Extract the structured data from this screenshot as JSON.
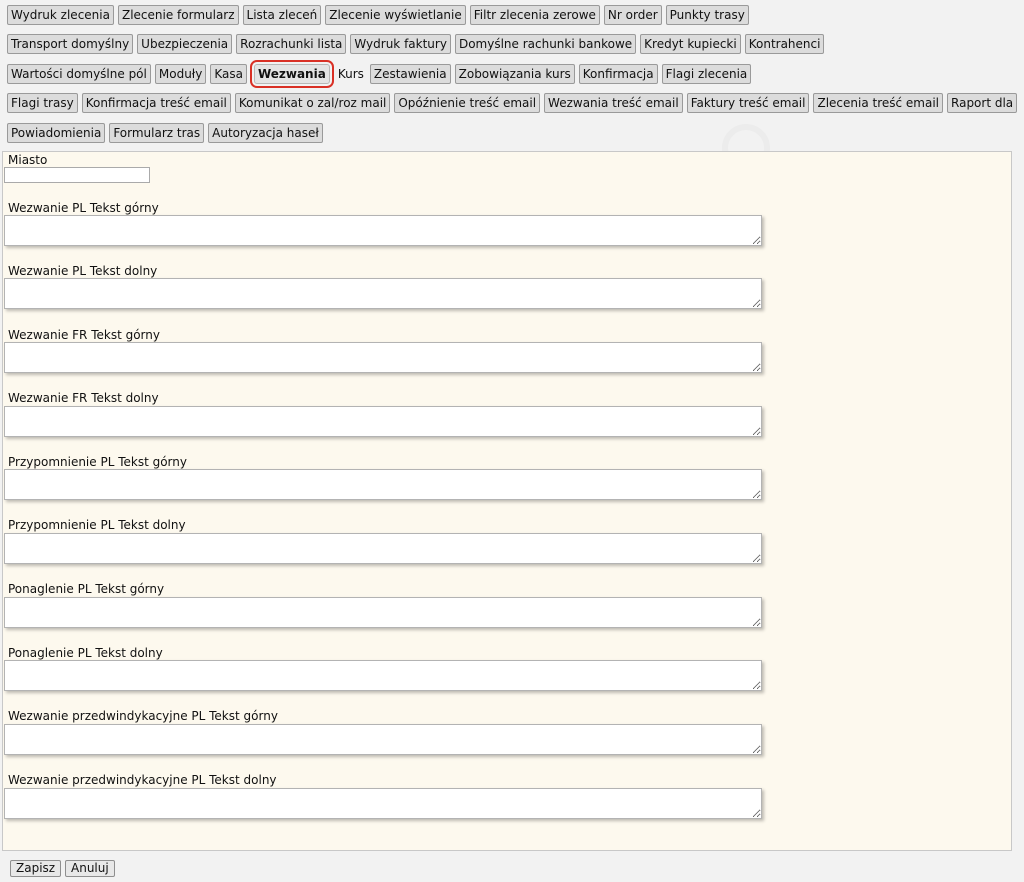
{
  "tabs": {
    "row1": [
      "Wydruk zlecenia",
      "Zlecenie formularz",
      "Lista zleceń",
      "Zlecenie wyświetlanie",
      "Filtr zlecenia zerowe",
      "Nr order",
      "Punkty trasy"
    ],
    "row2": [
      "Transport domyślny",
      "Ubezpieczenia",
      "Rozrachunki lista",
      "Wydruk faktury",
      "Domyślne rachunki bankowe",
      "Kredyt kupiecki",
      "Kontrahenci"
    ],
    "row3": [
      "Wartości domyślne pól",
      "Moduły",
      "Kasa",
      "Wezwania",
      "Kurs",
      "Zestawienia",
      "Zobowiązania kurs",
      "Konfirmacja",
      "Flagi zlecenia"
    ],
    "row4": [
      "Flagi trasy",
      "Konfirmacja treść email",
      "Komunikat o zal/roz mail",
      "Opóźnienie treść email",
      "Wezwania treść email",
      "Faktury treść email",
      "Zlecenia treść email",
      "Raport dla"
    ],
    "row5": [
      "Powiadomienia",
      "Formularz tras",
      "Autoryzacja haseł"
    ],
    "active": "Wezwania"
  },
  "form": {
    "city_label": "Miasto",
    "city_value": "",
    "fields": [
      {
        "label": "Wezwanie PL Tekst górny",
        "value": ""
      },
      {
        "label": "Wezwanie PL Tekst dolny",
        "value": ""
      },
      {
        "label": "Wezwanie FR Tekst górny",
        "value": ""
      },
      {
        "label": "Wezwanie FR Tekst dolny",
        "value": ""
      },
      {
        "label": "Przypomnienie PL Tekst górny",
        "value": ""
      },
      {
        "label": "Przypomnienie PL Tekst dolny",
        "value": ""
      },
      {
        "label": "Ponaglenie PL Tekst górny",
        "value": ""
      },
      {
        "label": "Ponaglenie PL Tekst dolny",
        "value": ""
      },
      {
        "label": "Wezwanie przedwindykacyjne PL Tekst górny",
        "value": ""
      },
      {
        "label": "Wezwanie przedwindykacyjne PL Tekst dolny",
        "value": ""
      }
    ]
  },
  "buttons": {
    "save": "Zapisz",
    "cancel": "Anuluj"
  },
  "colors": {
    "active_outline": "#d93025",
    "panel_background": "#fdf9ee"
  }
}
